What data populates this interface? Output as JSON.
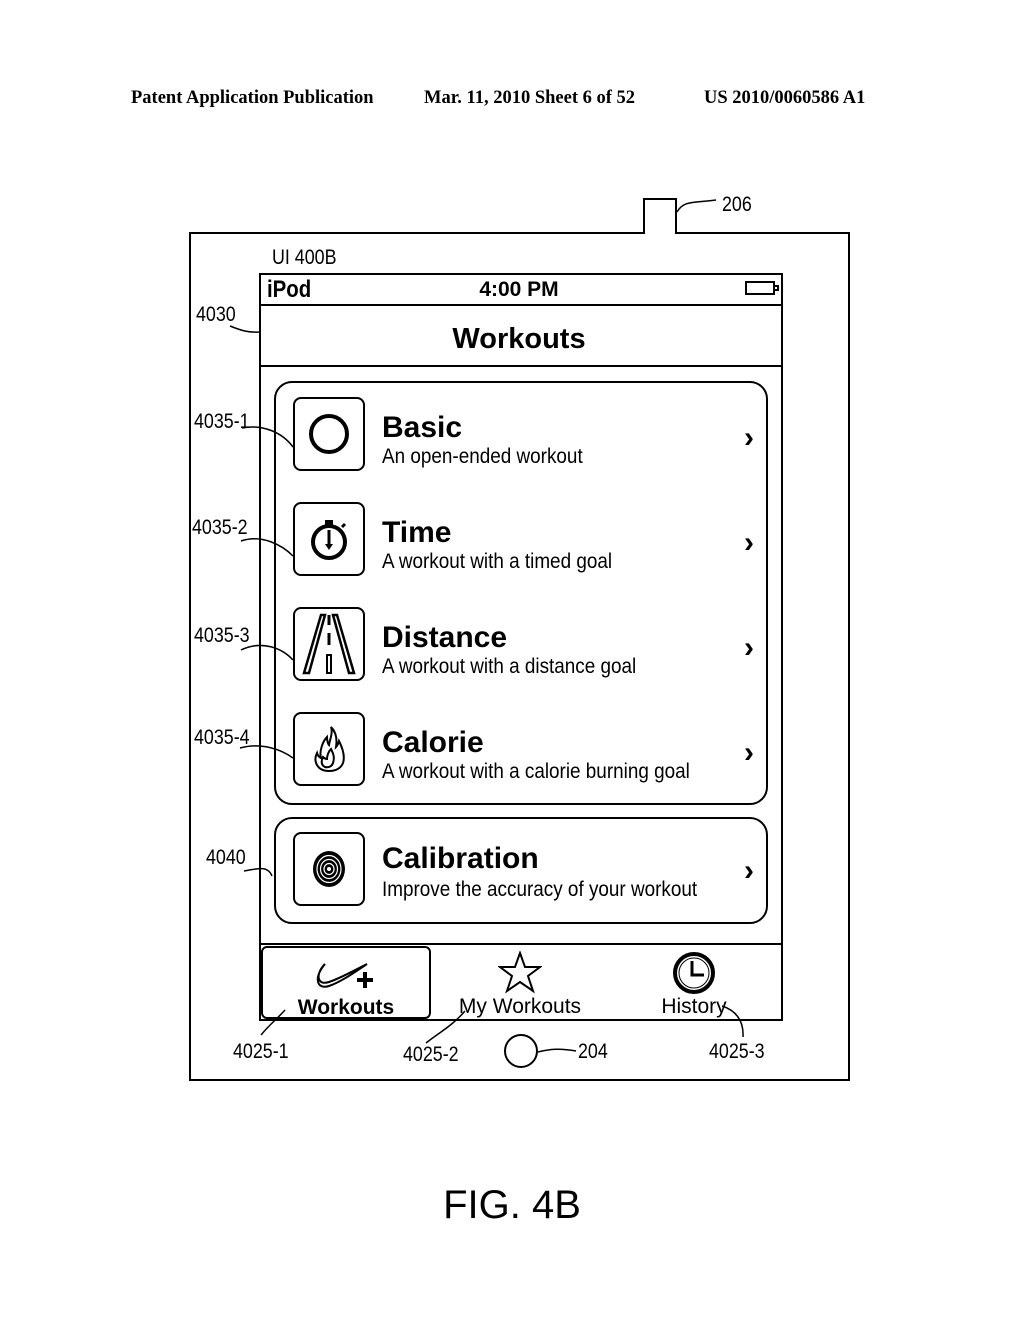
{
  "header": {
    "publication": "Patent Application Publication",
    "date_sheet": "Mar. 11, 2010  Sheet 6 of 52",
    "patent_number": "US 2010/0060586 A1"
  },
  "labels": {
    "ui": "UI 400B",
    "side_button": "206",
    "nav_bar": "4030",
    "item1": "4035-1",
    "item2": "4035-2",
    "item3": "4035-3",
    "item4": "4035-4",
    "calibration": "4040",
    "tab1": "4025-1",
    "tab2": "4025-2",
    "tab3": "4025-3",
    "home_button": "204"
  },
  "status_bar": {
    "carrier": "iPod",
    "time": "4:00 PM",
    "battery_icon": "battery-icon"
  },
  "nav": {
    "title": "Workouts"
  },
  "workouts": [
    {
      "title": "Basic",
      "subtitle": "An open-ended workout",
      "icon": "circle-icon"
    },
    {
      "title": "Time",
      "subtitle": "A workout with a timed goal",
      "icon": "stopwatch-icon"
    },
    {
      "title": "Distance",
      "subtitle": "A workout with a distance goal",
      "icon": "road-icon"
    },
    {
      "title": "Calorie",
      "subtitle": "A workout with a calorie burning goal",
      "icon": "flame-icon"
    }
  ],
  "calibration": {
    "title": "Calibration",
    "subtitle": "Improve the accuracy of your workout",
    "icon": "target-icon"
  },
  "chevron": "›",
  "tabs": [
    {
      "label": "Workouts",
      "icon": "swoosh-plus-icon",
      "active": true
    },
    {
      "label": "My Workouts",
      "icon": "star-icon",
      "active": false
    },
    {
      "label": "History",
      "icon": "clock-icon",
      "active": false
    }
  ],
  "figure_caption": "FIG. 4B"
}
